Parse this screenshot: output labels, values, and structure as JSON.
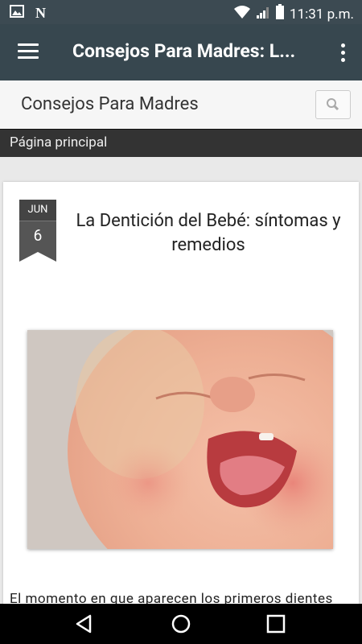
{
  "status_bar": {
    "time": "11:31 p.m.",
    "icons": [
      "image-icon",
      "n-icon",
      "wifi-icon",
      "signal-icon",
      "battery-icon"
    ]
  },
  "app_bar": {
    "title": "Consejos Para Madres: L...",
    "menu_icon": "hamburger-menu-icon",
    "more_icon": "more-vert-icon"
  },
  "blog": {
    "name": "Consejos Para Madres",
    "search_icon": "search-icon"
  },
  "nav": {
    "items": [
      "Página principal"
    ]
  },
  "post": {
    "date_month": "JUN",
    "date_day": "6",
    "title": "La Dentición del Bebé: síntomas y remedios",
    "body_start": "El momento en que aparecen los primeros dientes"
  },
  "system_nav": {
    "buttons": [
      "back-icon",
      "home-icon",
      "recents-icon"
    ]
  },
  "colors": {
    "status_bar": "#3c4a52",
    "app_bar": "#37474f",
    "nav_bar": "#333333"
  }
}
